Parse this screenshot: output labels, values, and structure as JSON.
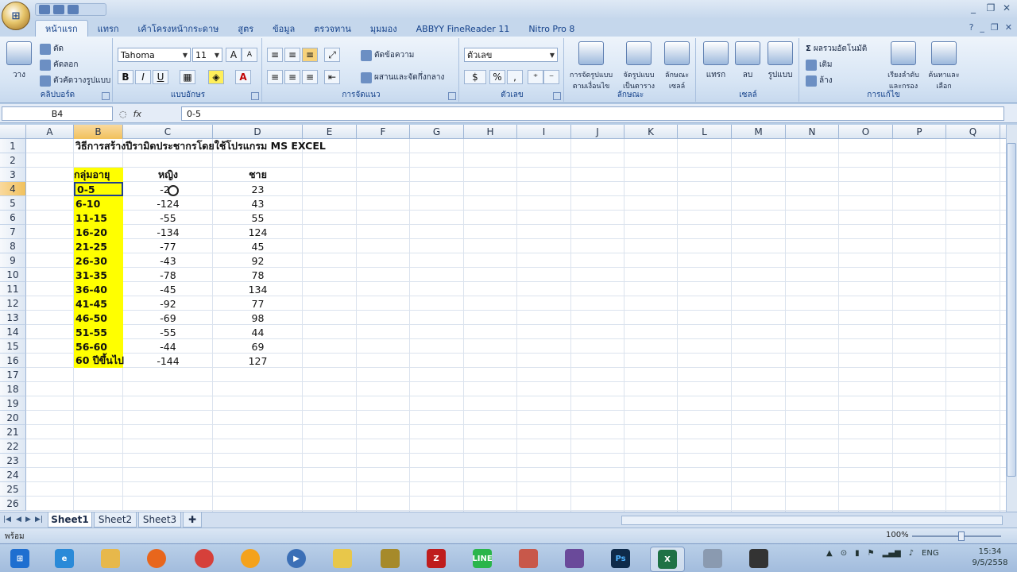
{
  "title": "",
  "ribbon": {
    "tabs": [
      "หน้าแรก",
      "แทรก",
      "เค้าโครงหน้ากระดาษ",
      "สูตร",
      "ข้อมูล",
      "ตรวจทาน",
      "มุมมอง",
      "ABBYY FineReader 11",
      "Nitro Pro 8"
    ],
    "clipboard": {
      "paste": "วาง",
      "cut": "ตัด",
      "copy": "คัดลอก",
      "format_painter": "ตัวคัดวางรูปแบบ",
      "label": "คลิปบอร์ด"
    },
    "font": {
      "name": "Tahoma",
      "size": "11",
      "bold": "B",
      "italic": "I",
      "underline": "U",
      "label": "แบบอักษร"
    },
    "alignment": {
      "wrap": "ตัดข้อความ",
      "merge": "ผสานและจัดกึ่งกลาง",
      "label": "การจัดแนว"
    },
    "number": {
      "format": "ตัวเลข",
      "percent": "%",
      "comma": ",",
      "label": "ตัวเลข"
    },
    "styles": {
      "conditional": "การจัดรูปแบบตามเงื่อนไข",
      "as_table": "จัดรูปแบบเป็นตาราง",
      "cell_styles": "ลักษณะเซลล์",
      "label": "ลักษณะ"
    },
    "cells": {
      "insert": "แทรก",
      "delete": "ลบ",
      "format": "รูปแบบ",
      "label": "เซลล์"
    },
    "editing": {
      "autosum": "ผลรวมอัตโนมัติ",
      "fill": "เติม",
      "clear": "ล้าง",
      "sort": "เรียงลำดับและกรอง",
      "find": "ค้นหาและเลือก",
      "label": "การแก้ไข"
    }
  },
  "formula_bar": {
    "name_box": "B4",
    "fx": "fx",
    "content": "0-5"
  },
  "columns": [
    "A",
    "B",
    "C",
    "D",
    "E",
    "F",
    "G",
    "H",
    "I",
    "J",
    "K",
    "L",
    "M",
    "N",
    "O",
    "P",
    "Q"
  ],
  "rows": [
    "1",
    "2",
    "3",
    "4",
    "5",
    "6",
    "7",
    "8",
    "9",
    "10",
    "11",
    "12",
    "13",
    "14",
    "15",
    "16",
    "17",
    "18",
    "19",
    "20",
    "21",
    "22",
    "23",
    "24",
    "25",
    "26"
  ],
  "sheet": {
    "title": "วิธีการสร้างปีรามิดประชากรโดยใช้โปรแกรม MS EXCEL",
    "headers": {
      "group": "กลุ่มอายุ",
      "female": "หญิง",
      "male": "ชาย"
    },
    "data": [
      {
        "group": "0-5",
        "female": "-23",
        "male": "23"
      },
      {
        "group": "6-10",
        "female": "-124",
        "male": "43"
      },
      {
        "group": "11-15",
        "female": "-55",
        "male": "55"
      },
      {
        "group": "16-20",
        "female": "-134",
        "male": "124"
      },
      {
        "group": "21-25",
        "female": "-77",
        "male": "45"
      },
      {
        "group": "26-30",
        "female": "-43",
        "male": "92"
      },
      {
        "group": "31-35",
        "female": "-78",
        "male": "78"
      },
      {
        "group": "36-40",
        "female": "-45",
        "male": "134"
      },
      {
        "group": "41-45",
        "female": "-92",
        "male": "77"
      },
      {
        "group": "46-50",
        "female": "-69",
        "male": "98"
      },
      {
        "group": "51-55",
        "female": "-55",
        "male": "44"
      },
      {
        "group": "56-60",
        "female": "-44",
        "male": "69"
      },
      {
        "group": "60 ปีขึ้นไป",
        "female": "-144",
        "male": "127"
      }
    ]
  },
  "sheet_tabs": [
    "Sheet1",
    "Sheet2",
    "Sheet3"
  ],
  "status": {
    "ready": "พร้อม",
    "zoom": "100%"
  },
  "taskbar": {
    "lang": "ENG",
    "time": "15:34",
    "date": "9/5/2558"
  },
  "colors": {
    "highlight": "#ffff00",
    "selection_border": "#1f3f8f",
    "ribbon_bg": "#d6e4f4"
  }
}
